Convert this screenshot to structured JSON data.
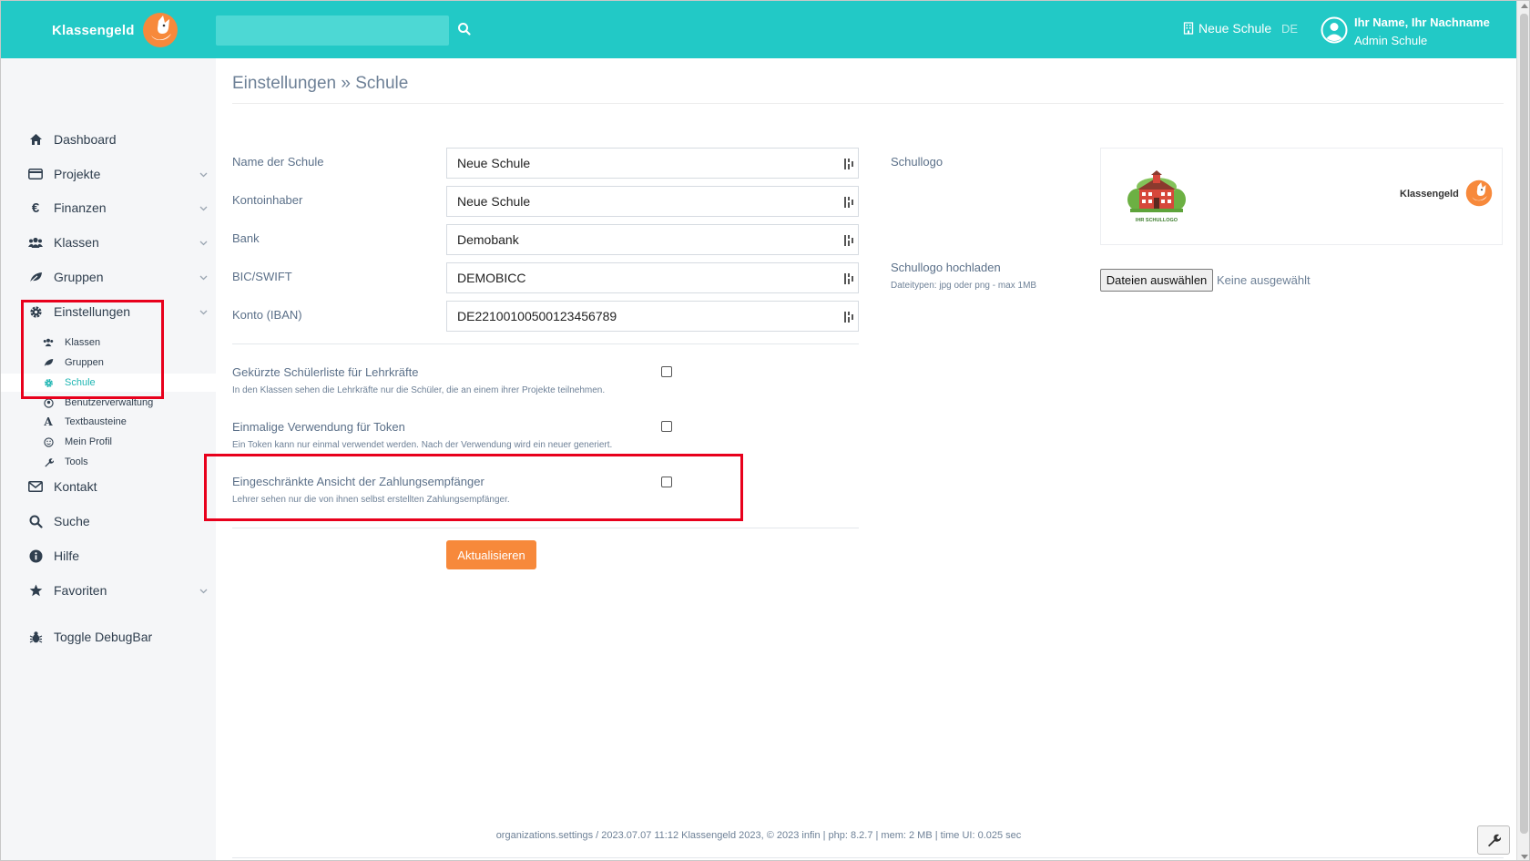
{
  "brand": {
    "name": "Klassengeld"
  },
  "search": {
    "placeholder": ""
  },
  "topbar": {
    "school": "Neue Schule",
    "lang": "DE",
    "user_name": "Ihr Name, Ihr Nachname",
    "user_role": "Admin Schule"
  },
  "sidebar": {
    "items": [
      {
        "label": "Dashboard",
        "icon": "home-icon"
      },
      {
        "label": "Projekte",
        "icon": "card-icon"
      },
      {
        "label": "Finanzen",
        "icon": "euro-icon"
      },
      {
        "label": "Klassen",
        "icon": "users-icon"
      },
      {
        "label": "Gruppen",
        "icon": "leaf-icon"
      },
      {
        "label": "Einstellungen",
        "icon": "gear-icon"
      },
      {
        "label": "Kontakt",
        "icon": "envelope-icon"
      },
      {
        "label": "Suche",
        "icon": "search-icon"
      },
      {
        "label": "Hilfe",
        "icon": "info-icon"
      },
      {
        "label": "Favoriten",
        "icon": "star-icon"
      },
      {
        "label": "Toggle DebugBar",
        "icon": "bug-icon"
      }
    ],
    "sub_items": [
      {
        "label": "Klassen",
        "icon": "users-icon"
      },
      {
        "label": "Gruppen",
        "icon": "leaf-icon"
      },
      {
        "label": "Schule",
        "icon": "gear-icon"
      },
      {
        "label": "Benutzerverwaltung",
        "icon": "user-icon"
      },
      {
        "label": "Textbausteine",
        "icon": "font-icon"
      },
      {
        "label": "Mein Profil",
        "icon": "smile-icon"
      },
      {
        "label": "Tools",
        "icon": "wrench-icon"
      }
    ]
  },
  "page": {
    "title": "Einstellungen » Schule"
  },
  "form": {
    "fields": [
      {
        "label": "Name der Schule",
        "value": "Neue Schule"
      },
      {
        "label": "Kontoinhaber",
        "value": "Neue Schule"
      },
      {
        "label": "Bank",
        "value": "Demobank"
      },
      {
        "label": "BIC/SWIFT",
        "value": "DEMOBICC"
      },
      {
        "label": "Konto (IBAN)",
        "value": "DE22100100500123456789"
      }
    ],
    "options": [
      {
        "title": "Gekürzte Schülerliste für Lehrkräfte",
        "desc": "In den Klassen sehen die Lehrkräfte nur die Schüler, die an einem ihrer Projekte teilnehmen.",
        "checked": false
      },
      {
        "title": "Einmalige Verwendung für Token",
        "desc": "Ein Token kann nur einmal verwendet werden. Nach der Verwendung wird ein neuer generiert.",
        "checked": false
      },
      {
        "title": "Eingeschränkte Ansicht der Zahlungsempfänger",
        "desc": "Lehrer sehen nur die von ihnen selbst erstellten Zahlungsempfänger.",
        "checked": false
      }
    ],
    "submit_label": "Aktualisieren"
  },
  "logo": {
    "label": "Schullogo",
    "school_logo_caption": "IHR SCHULLOGO",
    "kg_logo_text": "Klassengeld",
    "upload_label": "Schullogo hochladen",
    "upload_hint": "Dateitypen: jpg oder png - max 1MB",
    "file_button": "Dateien auswählen",
    "file_none": "Keine ausgewählt"
  },
  "footer": {
    "text": "organizations.settings / 2023.07.07 11:12 Klassengeld 2023, © 2023 infin | php: 8.2.7 | mem: 2 MB | time UI: 0.025 sec"
  },
  "colors": {
    "topbar": "#22c9c6",
    "accent": "#1fb6b3",
    "button": "#f7893b",
    "highlight": "#e8001c"
  }
}
